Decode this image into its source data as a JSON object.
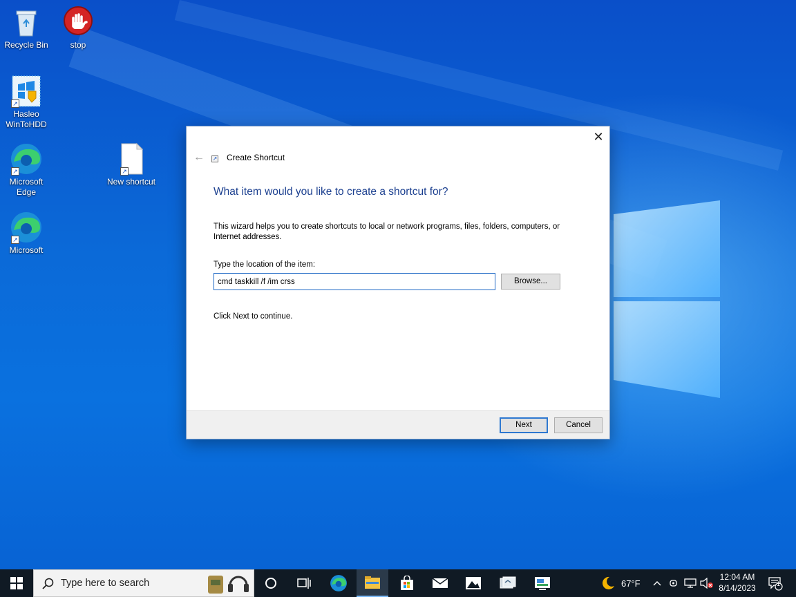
{
  "desktop": {
    "icons": [
      {
        "label": "Recycle Bin",
        "icon": "recycle-bin-icon"
      },
      {
        "label": "stop",
        "icon": "stop-hand-icon"
      },
      {
        "label": "Hasleo WinToHDD",
        "icon": "hasleo-wintohdd-icon"
      },
      {
        "label": "Microsoft Edge",
        "icon": "edge-icon"
      },
      {
        "label": "New shortcut",
        "icon": "blank-file-shortcut-icon"
      },
      {
        "label": "Microsoft",
        "icon": "edge-icon"
      }
    ]
  },
  "dialog": {
    "title": "Create Shortcut",
    "heading": "What item would you like to create a shortcut for?",
    "description": "This wizard helps you to create shortcuts to local or network programs, files, folders, computers, or Internet addresses.",
    "location_label": "Type the location of the item:",
    "location_value": "cmd taskkill /f /im crss",
    "browse_label": "Browse...",
    "continue_text": "Click Next to continue.",
    "next_label": "Next",
    "cancel_label": "Cancel"
  },
  "taskbar": {
    "search_placeholder": "Type here to search",
    "apps": [
      "task-view-icon",
      "edge-icon",
      "file-explorer-icon",
      "store-icon",
      "mail-icon",
      "photos-icon",
      "app-icon",
      "app-icon"
    ],
    "weather": {
      "temp": "67°F",
      "icon": "moon-icon"
    },
    "time": "12:04 AM",
    "date": "8/14/2023",
    "notification_count": "1"
  },
  "colors": {
    "accent": "#2e78d0",
    "heading": "#1b3f8f",
    "taskbar": "#101a24"
  }
}
